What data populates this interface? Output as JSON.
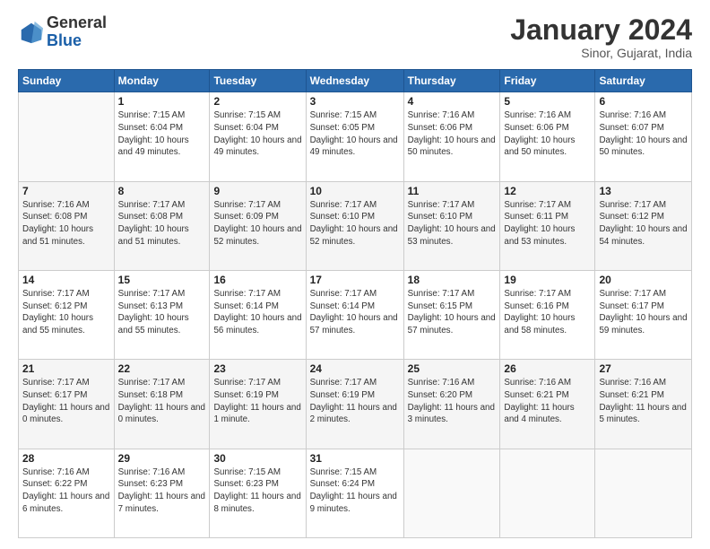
{
  "logo": {
    "line1": "General",
    "line2": "Blue"
  },
  "title": "January 2024",
  "subtitle": "Sinor, Gujarat, India",
  "days_header": [
    "Sunday",
    "Monday",
    "Tuesday",
    "Wednesday",
    "Thursday",
    "Friday",
    "Saturday"
  ],
  "weeks": [
    [
      {
        "num": "",
        "sunrise": "",
        "sunset": "",
        "daylight": ""
      },
      {
        "num": "1",
        "sunrise": "Sunrise: 7:15 AM",
        "sunset": "Sunset: 6:04 PM",
        "daylight": "Daylight: 10 hours and 49 minutes."
      },
      {
        "num": "2",
        "sunrise": "Sunrise: 7:15 AM",
        "sunset": "Sunset: 6:04 PM",
        "daylight": "Daylight: 10 hours and 49 minutes."
      },
      {
        "num": "3",
        "sunrise": "Sunrise: 7:15 AM",
        "sunset": "Sunset: 6:05 PM",
        "daylight": "Daylight: 10 hours and 49 minutes."
      },
      {
        "num": "4",
        "sunrise": "Sunrise: 7:16 AM",
        "sunset": "Sunset: 6:06 PM",
        "daylight": "Daylight: 10 hours and 50 minutes."
      },
      {
        "num": "5",
        "sunrise": "Sunrise: 7:16 AM",
        "sunset": "Sunset: 6:06 PM",
        "daylight": "Daylight: 10 hours and 50 minutes."
      },
      {
        "num": "6",
        "sunrise": "Sunrise: 7:16 AM",
        "sunset": "Sunset: 6:07 PM",
        "daylight": "Daylight: 10 hours and 50 minutes."
      }
    ],
    [
      {
        "num": "7",
        "sunrise": "Sunrise: 7:16 AM",
        "sunset": "Sunset: 6:08 PM",
        "daylight": "Daylight: 10 hours and 51 minutes."
      },
      {
        "num": "8",
        "sunrise": "Sunrise: 7:17 AM",
        "sunset": "Sunset: 6:08 PM",
        "daylight": "Daylight: 10 hours and 51 minutes."
      },
      {
        "num": "9",
        "sunrise": "Sunrise: 7:17 AM",
        "sunset": "Sunset: 6:09 PM",
        "daylight": "Daylight: 10 hours and 52 minutes."
      },
      {
        "num": "10",
        "sunrise": "Sunrise: 7:17 AM",
        "sunset": "Sunset: 6:10 PM",
        "daylight": "Daylight: 10 hours and 52 minutes."
      },
      {
        "num": "11",
        "sunrise": "Sunrise: 7:17 AM",
        "sunset": "Sunset: 6:10 PM",
        "daylight": "Daylight: 10 hours and 53 minutes."
      },
      {
        "num": "12",
        "sunrise": "Sunrise: 7:17 AM",
        "sunset": "Sunset: 6:11 PM",
        "daylight": "Daylight: 10 hours and 53 minutes."
      },
      {
        "num": "13",
        "sunrise": "Sunrise: 7:17 AM",
        "sunset": "Sunset: 6:12 PM",
        "daylight": "Daylight: 10 hours and 54 minutes."
      }
    ],
    [
      {
        "num": "14",
        "sunrise": "Sunrise: 7:17 AM",
        "sunset": "Sunset: 6:12 PM",
        "daylight": "Daylight: 10 hours and 55 minutes."
      },
      {
        "num": "15",
        "sunrise": "Sunrise: 7:17 AM",
        "sunset": "Sunset: 6:13 PM",
        "daylight": "Daylight: 10 hours and 55 minutes."
      },
      {
        "num": "16",
        "sunrise": "Sunrise: 7:17 AM",
        "sunset": "Sunset: 6:14 PM",
        "daylight": "Daylight: 10 hours and 56 minutes."
      },
      {
        "num": "17",
        "sunrise": "Sunrise: 7:17 AM",
        "sunset": "Sunset: 6:14 PM",
        "daylight": "Daylight: 10 hours and 57 minutes."
      },
      {
        "num": "18",
        "sunrise": "Sunrise: 7:17 AM",
        "sunset": "Sunset: 6:15 PM",
        "daylight": "Daylight: 10 hours and 57 minutes."
      },
      {
        "num": "19",
        "sunrise": "Sunrise: 7:17 AM",
        "sunset": "Sunset: 6:16 PM",
        "daylight": "Daylight: 10 hours and 58 minutes."
      },
      {
        "num": "20",
        "sunrise": "Sunrise: 7:17 AM",
        "sunset": "Sunset: 6:17 PM",
        "daylight": "Daylight: 10 hours and 59 minutes."
      }
    ],
    [
      {
        "num": "21",
        "sunrise": "Sunrise: 7:17 AM",
        "sunset": "Sunset: 6:17 PM",
        "daylight": "Daylight: 11 hours and 0 minutes."
      },
      {
        "num": "22",
        "sunrise": "Sunrise: 7:17 AM",
        "sunset": "Sunset: 6:18 PM",
        "daylight": "Daylight: 11 hours and 0 minutes."
      },
      {
        "num": "23",
        "sunrise": "Sunrise: 7:17 AM",
        "sunset": "Sunset: 6:19 PM",
        "daylight": "Daylight: 11 hours and 1 minute."
      },
      {
        "num": "24",
        "sunrise": "Sunrise: 7:17 AM",
        "sunset": "Sunset: 6:19 PM",
        "daylight": "Daylight: 11 hours and 2 minutes."
      },
      {
        "num": "25",
        "sunrise": "Sunrise: 7:16 AM",
        "sunset": "Sunset: 6:20 PM",
        "daylight": "Daylight: 11 hours and 3 minutes."
      },
      {
        "num": "26",
        "sunrise": "Sunrise: 7:16 AM",
        "sunset": "Sunset: 6:21 PM",
        "daylight": "Daylight: 11 hours and 4 minutes."
      },
      {
        "num": "27",
        "sunrise": "Sunrise: 7:16 AM",
        "sunset": "Sunset: 6:21 PM",
        "daylight": "Daylight: 11 hours and 5 minutes."
      }
    ],
    [
      {
        "num": "28",
        "sunrise": "Sunrise: 7:16 AM",
        "sunset": "Sunset: 6:22 PM",
        "daylight": "Daylight: 11 hours and 6 minutes."
      },
      {
        "num": "29",
        "sunrise": "Sunrise: 7:16 AM",
        "sunset": "Sunset: 6:23 PM",
        "daylight": "Daylight: 11 hours and 7 minutes."
      },
      {
        "num": "30",
        "sunrise": "Sunrise: 7:15 AM",
        "sunset": "Sunset: 6:23 PM",
        "daylight": "Daylight: 11 hours and 8 minutes."
      },
      {
        "num": "31",
        "sunrise": "Sunrise: 7:15 AM",
        "sunset": "Sunset: 6:24 PM",
        "daylight": "Daylight: 11 hours and 9 minutes."
      },
      {
        "num": "",
        "sunrise": "",
        "sunset": "",
        "daylight": ""
      },
      {
        "num": "",
        "sunrise": "",
        "sunset": "",
        "daylight": ""
      },
      {
        "num": "",
        "sunrise": "",
        "sunset": "",
        "daylight": ""
      }
    ]
  ]
}
